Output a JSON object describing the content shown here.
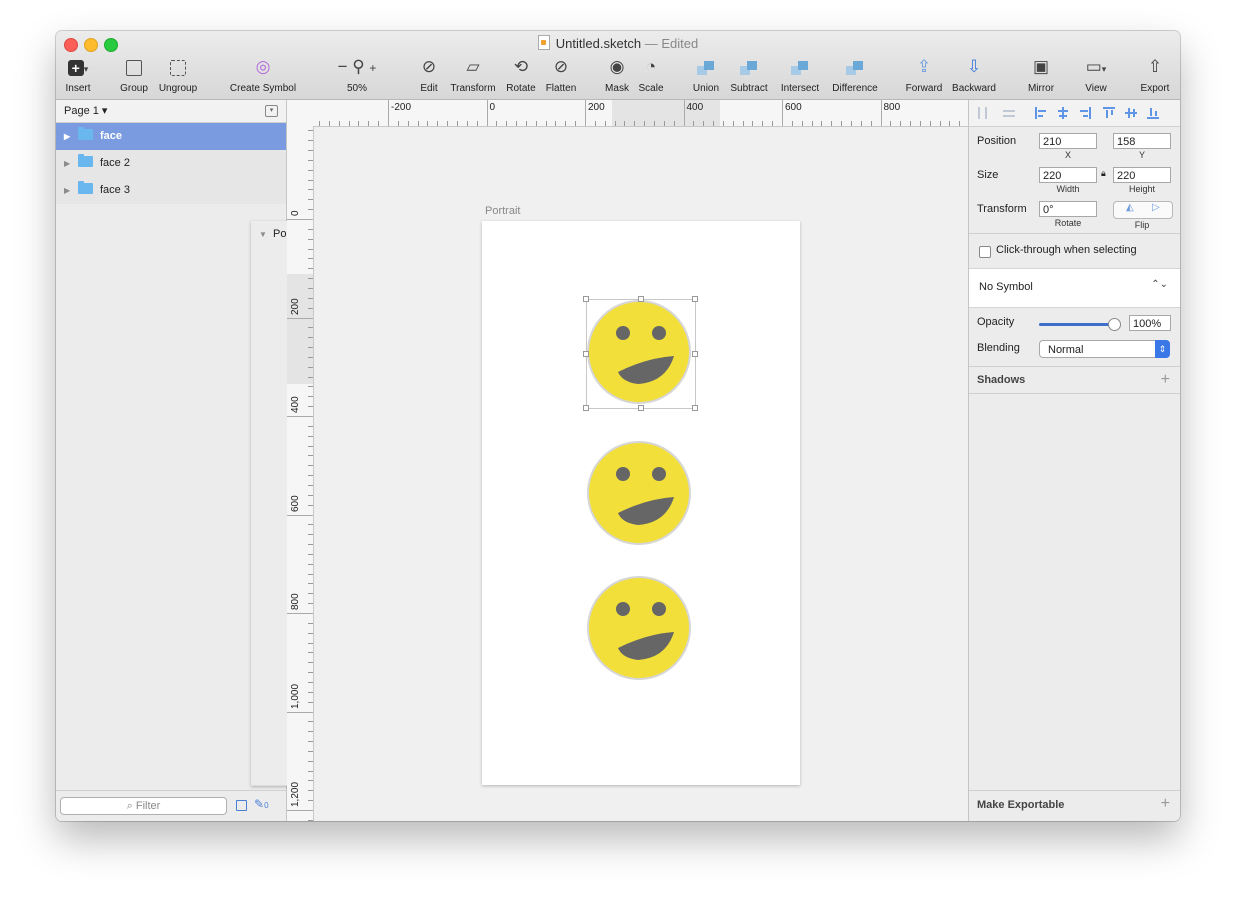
{
  "window": {
    "title": "Untitled.sketch",
    "separator": "—",
    "status": "Edited"
  },
  "toolbar": {
    "insert": "Insert",
    "group": "Group",
    "ungroup": "Ungroup",
    "create_symbol": "Create Symbol",
    "zoom_minus": "−",
    "zoom_plus": "+",
    "zoom": "50%",
    "edit": "Edit",
    "transform": "Transform",
    "rotate": "Rotate",
    "flatten": "Flatten",
    "mask": "Mask",
    "scale": "Scale",
    "union": "Union",
    "subtract": "Subtract",
    "intersect": "Intersect",
    "difference": "Difference",
    "forward": "Forward",
    "backward": "Backward",
    "mirror": "Mirror",
    "view": "View",
    "export": "Export"
  },
  "pages": {
    "current": "Page 1 ▾"
  },
  "layers": {
    "artboard": "Portrait",
    "groups": [
      {
        "name": "face",
        "selected": true
      },
      {
        "name": "face 2",
        "selected": false
      },
      {
        "name": "face 3",
        "selected": false
      }
    ]
  },
  "filter": {
    "placeholder": "Filter",
    "count": "0"
  },
  "canvas": {
    "artboard_label": "Portrait",
    "hruler_labels": [
      "-200",
      "0",
      "200",
      "400",
      "600",
      "800"
    ],
    "vruler_labels": [
      "0",
      "200",
      "400",
      "600",
      "800",
      "1,000",
      "1,200"
    ]
  },
  "inspector": {
    "position_label": "Position",
    "x": "210",
    "x_label": "X",
    "y": "158",
    "y_label": "Y",
    "size_label": "Size",
    "width": "220",
    "width_label": "Width",
    "height": "220",
    "height_label": "Height",
    "transform_label": "Transform",
    "rotate": "0°",
    "rotate_label": "Rotate",
    "flip_label": "Flip",
    "click_through": "Click-through when selecting",
    "symbol": "No Symbol",
    "opacity_label": "Opacity",
    "opacity": "100%",
    "blending_label": "Blending",
    "blending": "Normal",
    "shadows": "Shadows",
    "make_exportable": "Make Exportable"
  },
  "colors": {
    "face_fill": "#f2df39",
    "feature": "#666666",
    "selection": "#7b9be0",
    "accent": "#3b78e7"
  }
}
